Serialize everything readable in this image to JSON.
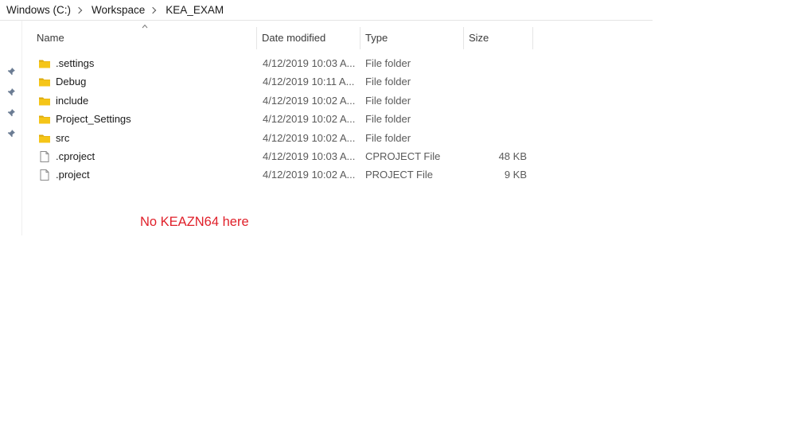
{
  "breadcrumb": {
    "items": [
      "Windows (C:)",
      "Workspace",
      "KEA_EXAM"
    ]
  },
  "columns": {
    "name": "Name",
    "date_modified": "Date modified",
    "type": "Type",
    "size": "Size"
  },
  "files": [
    {
      "name": ".settings",
      "date": "4/12/2019 10:03 A...",
      "type": "File folder",
      "size": "",
      "icon": "folder-icon"
    },
    {
      "name": "Debug",
      "date": "4/12/2019 10:11 A...",
      "type": "File folder",
      "size": "",
      "icon": "folder-icon"
    },
    {
      "name": "include",
      "date": "4/12/2019 10:02 A...",
      "type": "File folder",
      "size": "",
      "icon": "folder-icon"
    },
    {
      "name": "Project_Settings",
      "date": "4/12/2019 10:02 A...",
      "type": "File folder",
      "size": "",
      "icon": "folder-icon"
    },
    {
      "name": "src",
      "date": "4/12/2019 10:02 A...",
      "type": "File folder",
      "size": "",
      "icon": "folder-icon"
    },
    {
      "name": ".cproject",
      "date": "4/12/2019 10:03 A...",
      "type": "CPROJECT File",
      "size": "48 KB",
      "icon": "file-icon"
    },
    {
      "name": ".project",
      "date": "4/12/2019 10:02 A...",
      "type": "PROJECT File",
      "size": "9 KB",
      "icon": "file-icon"
    }
  ],
  "annotation": {
    "text": "No KEAZN64 here",
    "color": "#e0202a"
  },
  "colors": {
    "folder": "#f5c518",
    "folder_shade": "#dba90f"
  }
}
